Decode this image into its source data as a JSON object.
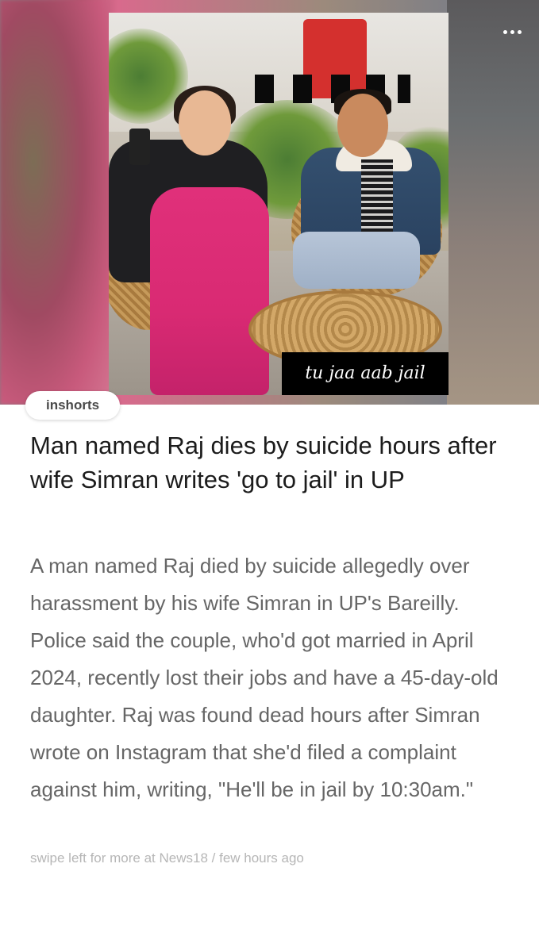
{
  "hero": {
    "image_caption": "tu jaa aab jail",
    "more_icon": "more-horizontal-icon"
  },
  "brand": {
    "label": "inshorts"
  },
  "article": {
    "headline": "Man named Raj dies by suicide hours after wife Simran writes 'go to jail' in UP",
    "summary": "A man named Raj died by suicide allegedly over harassment by his wife Simran in UP's Bareilly. Police said the couple, who'd got married in April 2024, recently lost their jobs and have a 45-day-old daughter. Raj was found dead hours after Simran wrote on Instagram that she'd filed a complaint against him, writing, \"He'll be in jail by 10:30am.\"",
    "source_line": "swipe left for more at News18 / few hours ago"
  },
  "colors": {
    "headline": "#1c1c1c",
    "summary": "#666666",
    "source": "#b6b6b6",
    "saree": "#d92a73"
  }
}
